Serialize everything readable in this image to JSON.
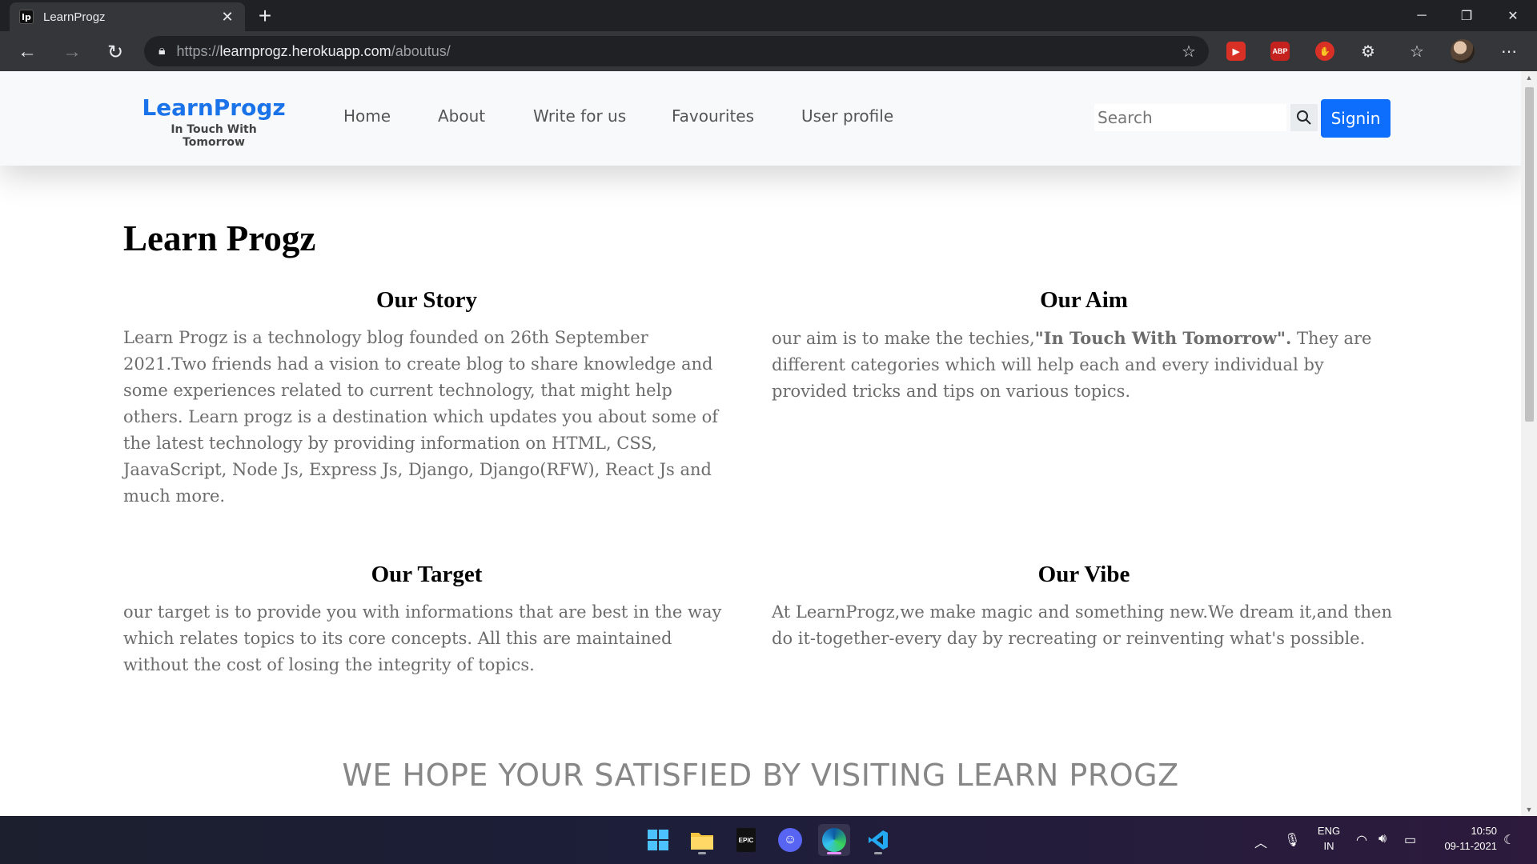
{
  "browser": {
    "tab_title": "LearnProgz",
    "tab_favicon": "lp",
    "url_scheme": "https://",
    "url_host": "learnprogz.herokuapp.com",
    "url_path": "/aboutus/"
  },
  "site": {
    "brand_name": "LearnProgz",
    "brand_tagline": "In Touch With Tomorrow",
    "nav": [
      "Home",
      "About",
      "Write for us",
      "Favourites",
      "User profile"
    ],
    "search_placeholder": "Search",
    "signin_label": "Signin"
  },
  "content": {
    "title": "Learn Progz",
    "story": {
      "heading": "Our Story",
      "text": "Learn Progz is a technology blog founded on 26th September 2021.Two friends had a vision to create blog to share knowledge and some experiences related to current technology, that might help others. Learn progz is a destination which updates you about some of the latest technology by providing information on HTML, CSS, JaavaScript, Node Js, Express Js, Django, Django(RFW), React Js and much more."
    },
    "aim": {
      "heading": "Our Aim",
      "text_before": "our aim is to make the techies,",
      "text_bold": "\"In Touch With Tomorrow\".",
      "text_after": " They are different categories which will help each and every individual by provided tricks and tips on various topics."
    },
    "target": {
      "heading": "Our Target",
      "text": "our target is to provide you with informations that are best in the way which relates topics to its core concepts. All this are maintained without the cost of losing the integrity of topics."
    },
    "vibe": {
      "heading": "Our Vibe",
      "text": "At LearnProgz,we make magic and something new.We dream it,and then do it-together-every day by recreating or reinventing what's possible."
    },
    "footer_message": "WE HOPE YOUR SATISFIED BY VISITING LEARN PROGZ"
  },
  "taskbar": {
    "apps": [
      "windows-start",
      "file-explorer",
      "epic-games",
      "discord",
      "edge",
      "vscode"
    ],
    "language_line1": "ENG",
    "language_line2": "IN",
    "time": "10:50",
    "date": "09-11-2021"
  }
}
